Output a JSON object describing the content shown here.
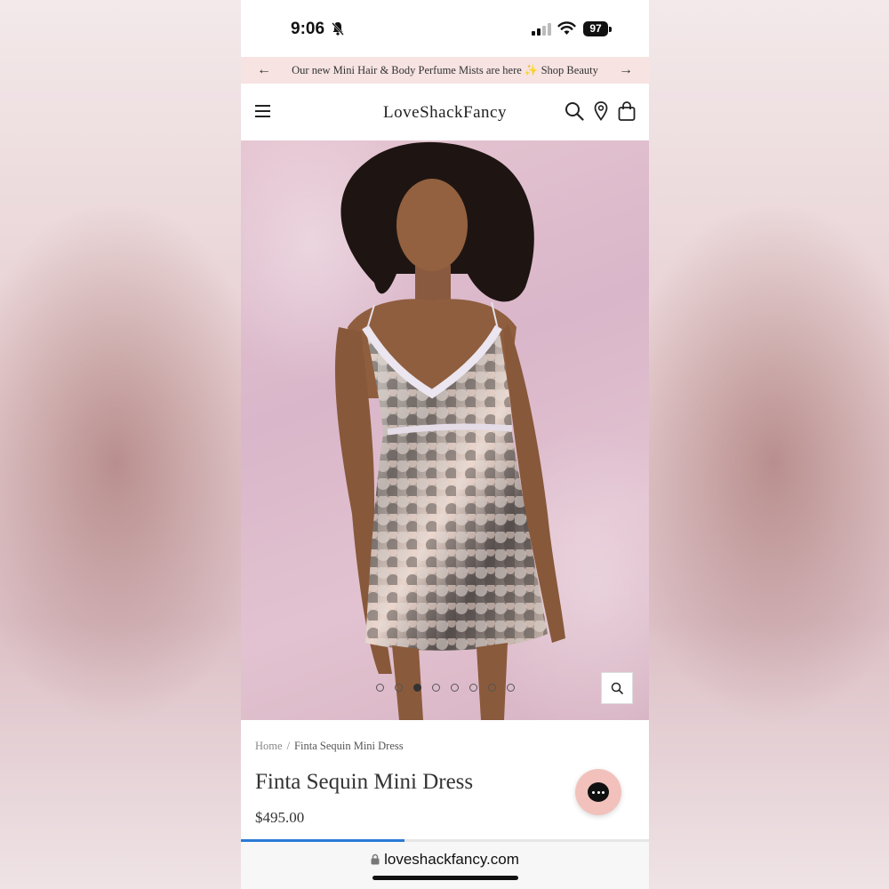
{
  "status_bar": {
    "time": "9:06",
    "battery": "97",
    "icons": [
      "bell-slash-icon",
      "cellular-signal-icon",
      "wifi-icon",
      "battery-icon"
    ]
  },
  "announcement": {
    "text": "Our new Mini Hair & Body Perfume Mists are here",
    "sparkle": "✨",
    "link": "Shop Beauty",
    "prev_icon": "arrow-left-icon",
    "next_icon": "arrow-right-icon"
  },
  "header": {
    "logo": "LoveShackFancy",
    "icons": [
      "menu-icon",
      "search-icon",
      "location-pin-icon",
      "shopping-bag-icon"
    ]
  },
  "gallery": {
    "image_count": 8,
    "active_index": 2,
    "zoom_icon": "search-icon"
  },
  "breadcrumb": {
    "home": "Home",
    "separator": "/",
    "current": "Finta Sequin Mini Dress"
  },
  "product": {
    "title": "Finta Sequin Mini Dress",
    "price": "$495.00"
  },
  "browser": {
    "url": "loveshackfancy.com",
    "load_progress": 0.4
  },
  "colors": {
    "announcement_bg": "#f6e3e2",
    "chat_button": "#f2c1bc",
    "progress": "#2a7ad6"
  }
}
